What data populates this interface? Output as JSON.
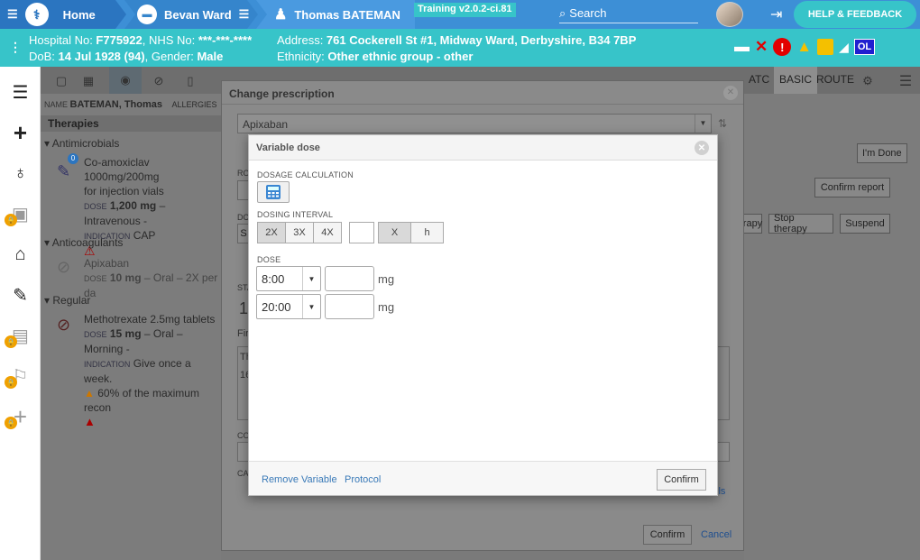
{
  "topbar": {
    "home": "Home",
    "ward": "Bevan Ward",
    "patient": "Thomas BATEMAN",
    "training": "Training v2.0.2-ci.81",
    "search": "Search",
    "help": "HELP & FEEDBACK"
  },
  "patient_banner": {
    "hospital_label": "Hospital No: ",
    "hospital_no": "F775922",
    "nhs_label": ", NHS No: ",
    "nhs_no": "***-***-****",
    "dob_label": "DoB: ",
    "dob": "14 Jul 1928 (94)",
    "gender_label": ", Gender: ",
    "gender": "Male",
    "address_label": "Address: ",
    "address": "761 Cockerell St #1, Midway Ward, Derbyshire, B34 7BP",
    "ethnicity_label": "Ethnicity: ",
    "ethnicity": "Other ethnic group - other",
    "alert_ol": "OL"
  },
  "toolbar": {
    "tab_atc": "ATC",
    "tab_basic": "BASIC",
    "tab_route": "ROUTE"
  },
  "left_pane": {
    "name_label": "NAME",
    "name": "BATEMAN, Thomas",
    "allergies_label": "ALLERGIES",
    "therapies": "Therapies",
    "groups": [
      {
        "title": "Antimicrobials",
        "drug": "Co-amoxiclav 1000mg/200mg",
        "drug2": "for injection vials",
        "dose_label": "DOSE",
        "dose": "1,200 mg",
        "dose_rest": " – Intravenous -",
        "ind_label": "INDICATION",
        "indication": "CAP",
        "badge": "0"
      },
      {
        "title": "Anticoagulants",
        "drug": "Apixaban",
        "dose_label": "DOSE",
        "dose": "10 mg",
        "dose_rest": " – Oral – 2X per da"
      },
      {
        "title": "Regular",
        "drug": "Methotrexate 2.5mg tablets",
        "dose_label": "DOSE",
        "dose": "15 mg",
        "dose_rest": " – Oral – Morning -",
        "ind_label": "INDICATION",
        "indication": "Give once a week.",
        "warning": "60% of the maximum recon"
      }
    ]
  },
  "right_pane": {
    "im_done": "I'm Done",
    "confirm_report": "Confirm report",
    "therapy_frag": "rapy",
    "stop_therapy": "Stop therapy",
    "suspend": "Suspend"
  },
  "change_prescription": {
    "title": "Change prescription",
    "drug": "Apixaban",
    "confirm": "Confirm",
    "cancel": "Cancel",
    "fragment_ro": "RO",
    "fragment_dc": "DC",
    "fragment_sta": "STA",
    "fragment_fir": "Fir",
    "fragment_co": "CO",
    "fragment_ca": "CA",
    "fragment_s": "S",
    "fragment_1": "1",
    "fragment_th": "Th",
    "fragment_16": "16",
    "fragment_lls": "lls"
  },
  "variable_dose": {
    "title": "Variable dose",
    "dosage_calc_label": "DOSAGE CALCULATION",
    "dosing_interval_label": "DOSING INTERVAL",
    "interval_options": [
      "2X",
      "3X",
      "4X"
    ],
    "mult_x": "X",
    "mult_h": "h",
    "dose_label": "DOSE",
    "doses": [
      {
        "time": "8:00",
        "amount": "",
        "unit": "mg"
      },
      {
        "time": "20:00",
        "amount": "",
        "unit": "mg"
      }
    ],
    "remove_variable": "Remove Variable",
    "protocol": "Protocol",
    "confirm": "Confirm"
  }
}
